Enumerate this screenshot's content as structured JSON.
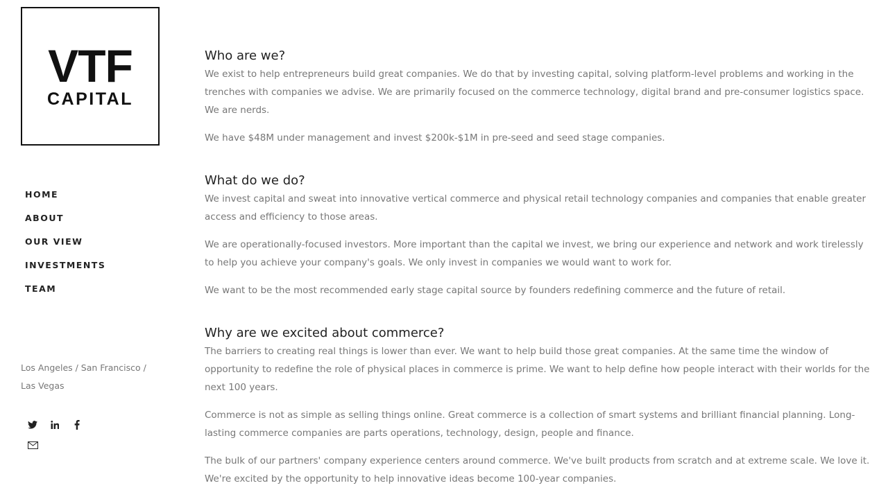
{
  "logo": {
    "line1": "VTF",
    "line2": "CAPITAL"
  },
  "nav": {
    "items": [
      {
        "label": "HOME"
      },
      {
        "label": "ABOUT"
      },
      {
        "label": "OUR VIEW"
      },
      {
        "label": "INVESTMENTS"
      },
      {
        "label": "TEAM"
      }
    ]
  },
  "locations": "Los Angeles / San Francisco / Las Vegas",
  "social": {
    "icons": [
      "twitter-icon",
      "linkedin-icon",
      "facebook-icon",
      "email-icon"
    ]
  },
  "sections": [
    {
      "heading": "Who are we?",
      "paragraphs": [
        "We exist to help entrepreneurs build great companies. We do that by investing capital, solving platform-level problems and working in the trenches with companies we advise. We are primarily focused on the commerce technology, digital brand and pre-consumer logistics space. We are nerds.",
        "We have $48M under management and invest $200k-$1M in pre-seed and seed stage companies."
      ]
    },
    {
      "heading": "What do we do?",
      "paragraphs": [
        "We invest capital and sweat into innovative vertical commerce and physical retail technology companies and companies that enable greater access and efficiency to those areas.",
        "We are operationally-focused investors. More important than the capital we invest, we bring our experience and network and work tirelessly to help you achieve your company's goals. We only invest in companies we would want to work for.",
        "We want to be the most recommended early stage capital source by founders redefining commerce and the future of retail."
      ]
    },
    {
      "heading": "Why are we excited about commerce?",
      "paragraphs": [
        "The barriers to creating real things is lower than ever. We want to help build those great companies. At the same time the window of opportunity to redefine the role of physical places in commerce is prime. We want to help define how people interact with their worlds for the next 100 years.",
        "Commerce is not as simple as selling things online. Great commerce is a collection of smart systems and brilliant financial planning. Long-lasting commerce companies are parts operations, technology, design, people and finance.",
        "The bulk of our partners' company experience centers around commerce. We've built products from scratch and at extreme scale. We love it. We're excited by the opportunity to help innovative ideas become 100-year companies."
      ]
    }
  ]
}
